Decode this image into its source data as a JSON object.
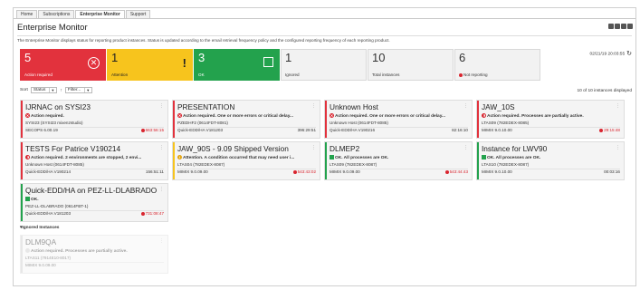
{
  "tabs": [
    {
      "label": "Home",
      "active": false
    },
    {
      "label": "Subscriptions",
      "active": false
    },
    {
      "label": "Enterprise Monitor",
      "active": true
    },
    {
      "label": "Support",
      "active": false
    }
  ],
  "page": {
    "title": "Enterprise Monitor",
    "description": "The Enterprise Monitor displays status for reporting product instances. Status is updated according to the email retrieval frequency policy and the configured reporting frequency of each reporting product.",
    "timestamp": "02/21/19 20:03:55",
    "refresh_icon": "refresh-icon"
  },
  "summary": [
    {
      "count": "5",
      "label": "Action required",
      "style": "red",
      "icon": "circle-x-icon"
    },
    {
      "count": "1",
      "label": "Attention",
      "style": "yellow",
      "icon": "exclamation-icon"
    },
    {
      "count": "3",
      "label": "OK",
      "style": "green",
      "icon": "square-icon"
    },
    {
      "count": "1",
      "label": "Ignored",
      "style": "grey",
      "icon": ""
    },
    {
      "count": "10",
      "label": "Total instances",
      "style": "grey",
      "icon": ""
    },
    {
      "count": "6",
      "label": "Not reporting",
      "style": "grey",
      "icon": "red-dot-icon"
    }
  ],
  "toolbar": {
    "sort_label": "Sort",
    "sort_value": "Status",
    "filter_value": "Filter...",
    "count_text": "10 of 10 instances displayed"
  },
  "colors": {
    "red": "#e2323d",
    "yellow": "#f7c41d",
    "green": "#23a24d",
    "alert_text": "#d9252f"
  },
  "instances": [
    {
      "name": "IJRNAC on SYSI23",
      "status": "Action required.",
      "status_type": "err",
      "host": "SYSI23 (SYSI23 mixenzstudio)",
      "version": "SECOPS 6.00.19",
      "duration": "663:56:15",
      "alert": true,
      "bar": "#e2323d"
    },
    {
      "name": "PRESENTATION",
      "status": "Action required. One or more errors or critical delay...",
      "status_type": "err",
      "host": "PZEDHF2 (0614FDT-8081)",
      "version": "Quick-EDD/HA V181203",
      "duration": "396:29:51",
      "alert": false,
      "bar": "#e2323d"
    },
    {
      "name": "Unknown Host",
      "status": "Action required. One or more errors or critical delay...",
      "status_type": "err",
      "host": "Unknown Host (0614FDT-8085)",
      "version": "Quick-EDD/HA V190216",
      "duration": "82:16:10",
      "alert": false,
      "bar": "#e2323d"
    },
    {
      "name": "JAW_10S",
      "status": "Action required. Processes are partially active.",
      "status_type": "half",
      "host": "LTAS09 (782EDEX-8085)",
      "version": "MIMIX 9.0.10.00",
      "duration": "29:15:48",
      "alert": true,
      "bar": "#e2323d"
    },
    {
      "name": "TESTS For Patrice V190214",
      "status": "Action required. 2 environments are stopped, 2 envi...",
      "status_type": "half",
      "host": "Unknown Host (0614FDT-8085)",
      "version": "Quick-EDD/HA V190214",
      "duration": "156:51:11",
      "alert": false,
      "bar": "#e2323d"
    },
    {
      "name": "JAW_90S - 9.09 Shipped Version",
      "status": "Attention. A condition occurred that may need user i...",
      "status_type": "warn",
      "host": "LTAS04 (782EDEX-8087)",
      "version": "MIMIX 9.0.09.00",
      "duration": "543:43:02",
      "alert": true,
      "bar": "#f7c41d"
    },
    {
      "name": "DLMEP2",
      "status": "OK. All processes are OK.",
      "status_type": "ok",
      "host": "LTAS09 (782EDEX-8087)",
      "version": "MIMIX 9.0.09.00",
      "duration": "543:44:43",
      "alert": true,
      "bar": "#23a24d"
    },
    {
      "name": "Instance for LWV90",
      "status": "OK. All processes are OK.",
      "status_type": "ok",
      "host": "LTAS10 (782EDEX-8087)",
      "version": "MIMIX 9.0.10.00",
      "duration": "00:03:16",
      "alert": false,
      "bar": "#23a24d"
    },
    {
      "name": "Quick-EDD/HA on PEZ-LL-DLABRADO",
      "status": "OK.",
      "status_type": "ok",
      "host": "PEZ-LL-DLABRADO (0614FBT-1)",
      "version": "Quick-EDD/HA V181203",
      "duration": "731:08:47",
      "alert": true,
      "bar": "#23a24d"
    }
  ],
  "ignored": {
    "header": "Ignored Instances",
    "instances": [
      {
        "name": "DLM9QA",
        "status": "Action required. Processes are partially active.",
        "status_type": "grey",
        "host": "LTAS11 (7914E10-8017)",
        "version": "MIMIX 9.0.09.00",
        "duration": "",
        "alert": false,
        "bar": "#cccccc"
      }
    ]
  }
}
